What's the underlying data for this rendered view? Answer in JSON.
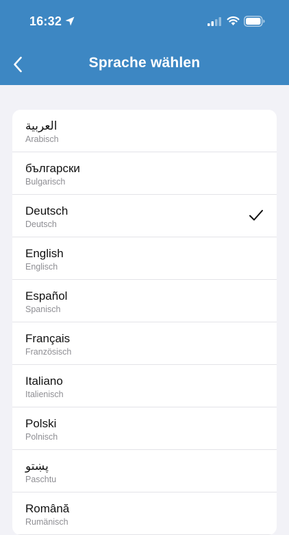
{
  "status_bar": {
    "time": "16:32"
  },
  "header": {
    "title": "Sprache wählen",
    "back_icon": "chevron-left-icon",
    "background_color": "#3d87c3"
  },
  "languages": [
    {
      "native": "العربية",
      "german": "Arabisch",
      "selected": false
    },
    {
      "native": "български",
      "german": "Bulgarisch",
      "selected": false
    },
    {
      "native": "Deutsch",
      "german": "Deutsch",
      "selected": true
    },
    {
      "native": "English",
      "german": "Englisch",
      "selected": false
    },
    {
      "native": "Español",
      "german": "Spanisch",
      "selected": false
    },
    {
      "native": "Français",
      "german": "Französisch",
      "selected": false
    },
    {
      "native": "Italiano",
      "german": "Italienisch",
      "selected": false
    },
    {
      "native": "Polski",
      "german": "Polnisch",
      "selected": false
    },
    {
      "native": "پښتو",
      "german": "Paschtu",
      "selected": false
    },
    {
      "native": "Română",
      "german": "Rumänisch",
      "selected": false
    }
  ]
}
